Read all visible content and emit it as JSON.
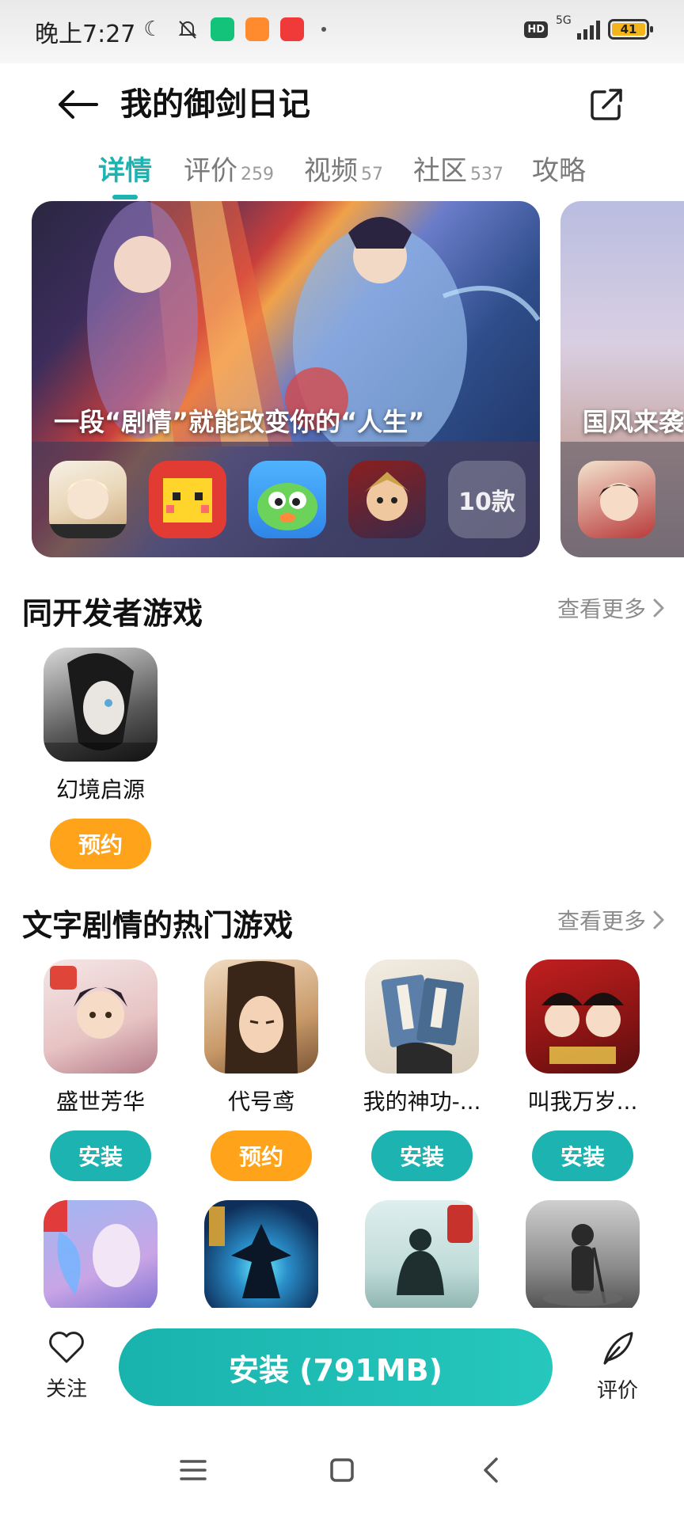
{
  "status_bar": {
    "time": "晚上7:27",
    "hd": "HD",
    "network": "5G",
    "battery": "41"
  },
  "header": {
    "title": "我的御剑日记"
  },
  "tabs": [
    {
      "label": "详情",
      "count": ""
    },
    {
      "label": "评价",
      "count": "259"
    },
    {
      "label": "视频",
      "count": "57"
    },
    {
      "label": "社区",
      "count": "537"
    },
    {
      "label": "攻略",
      "count": ""
    }
  ],
  "banners": [
    {
      "caption": "一段“剧情”就能改变你的“人生”",
      "more_label": "10款"
    },
    {
      "caption": "国风来袭"
    }
  ],
  "sections": {
    "developer": {
      "title": "同开发者游戏",
      "more": "查看更多",
      "games": [
        {
          "name": "幻境启源",
          "action": "预约"
        }
      ]
    },
    "popular": {
      "title": "文字剧情的热门游戏",
      "more": "查看更多",
      "games": [
        {
          "name": "盛世芳华",
          "action": "安装"
        },
        {
          "name": "代号鸢",
          "action": "预约"
        },
        {
          "name": "我的神功-...",
          "action": "安装"
        },
        {
          "name": "叫我万岁...",
          "action": "安装"
        }
      ]
    }
  },
  "bottom_bar": {
    "follow_label": "关注",
    "install_label": "安装 (791MB)",
    "rate_label": "评价"
  },
  "colors": {
    "accent": "#1cb3b0",
    "reserve": "#ffa31a"
  }
}
